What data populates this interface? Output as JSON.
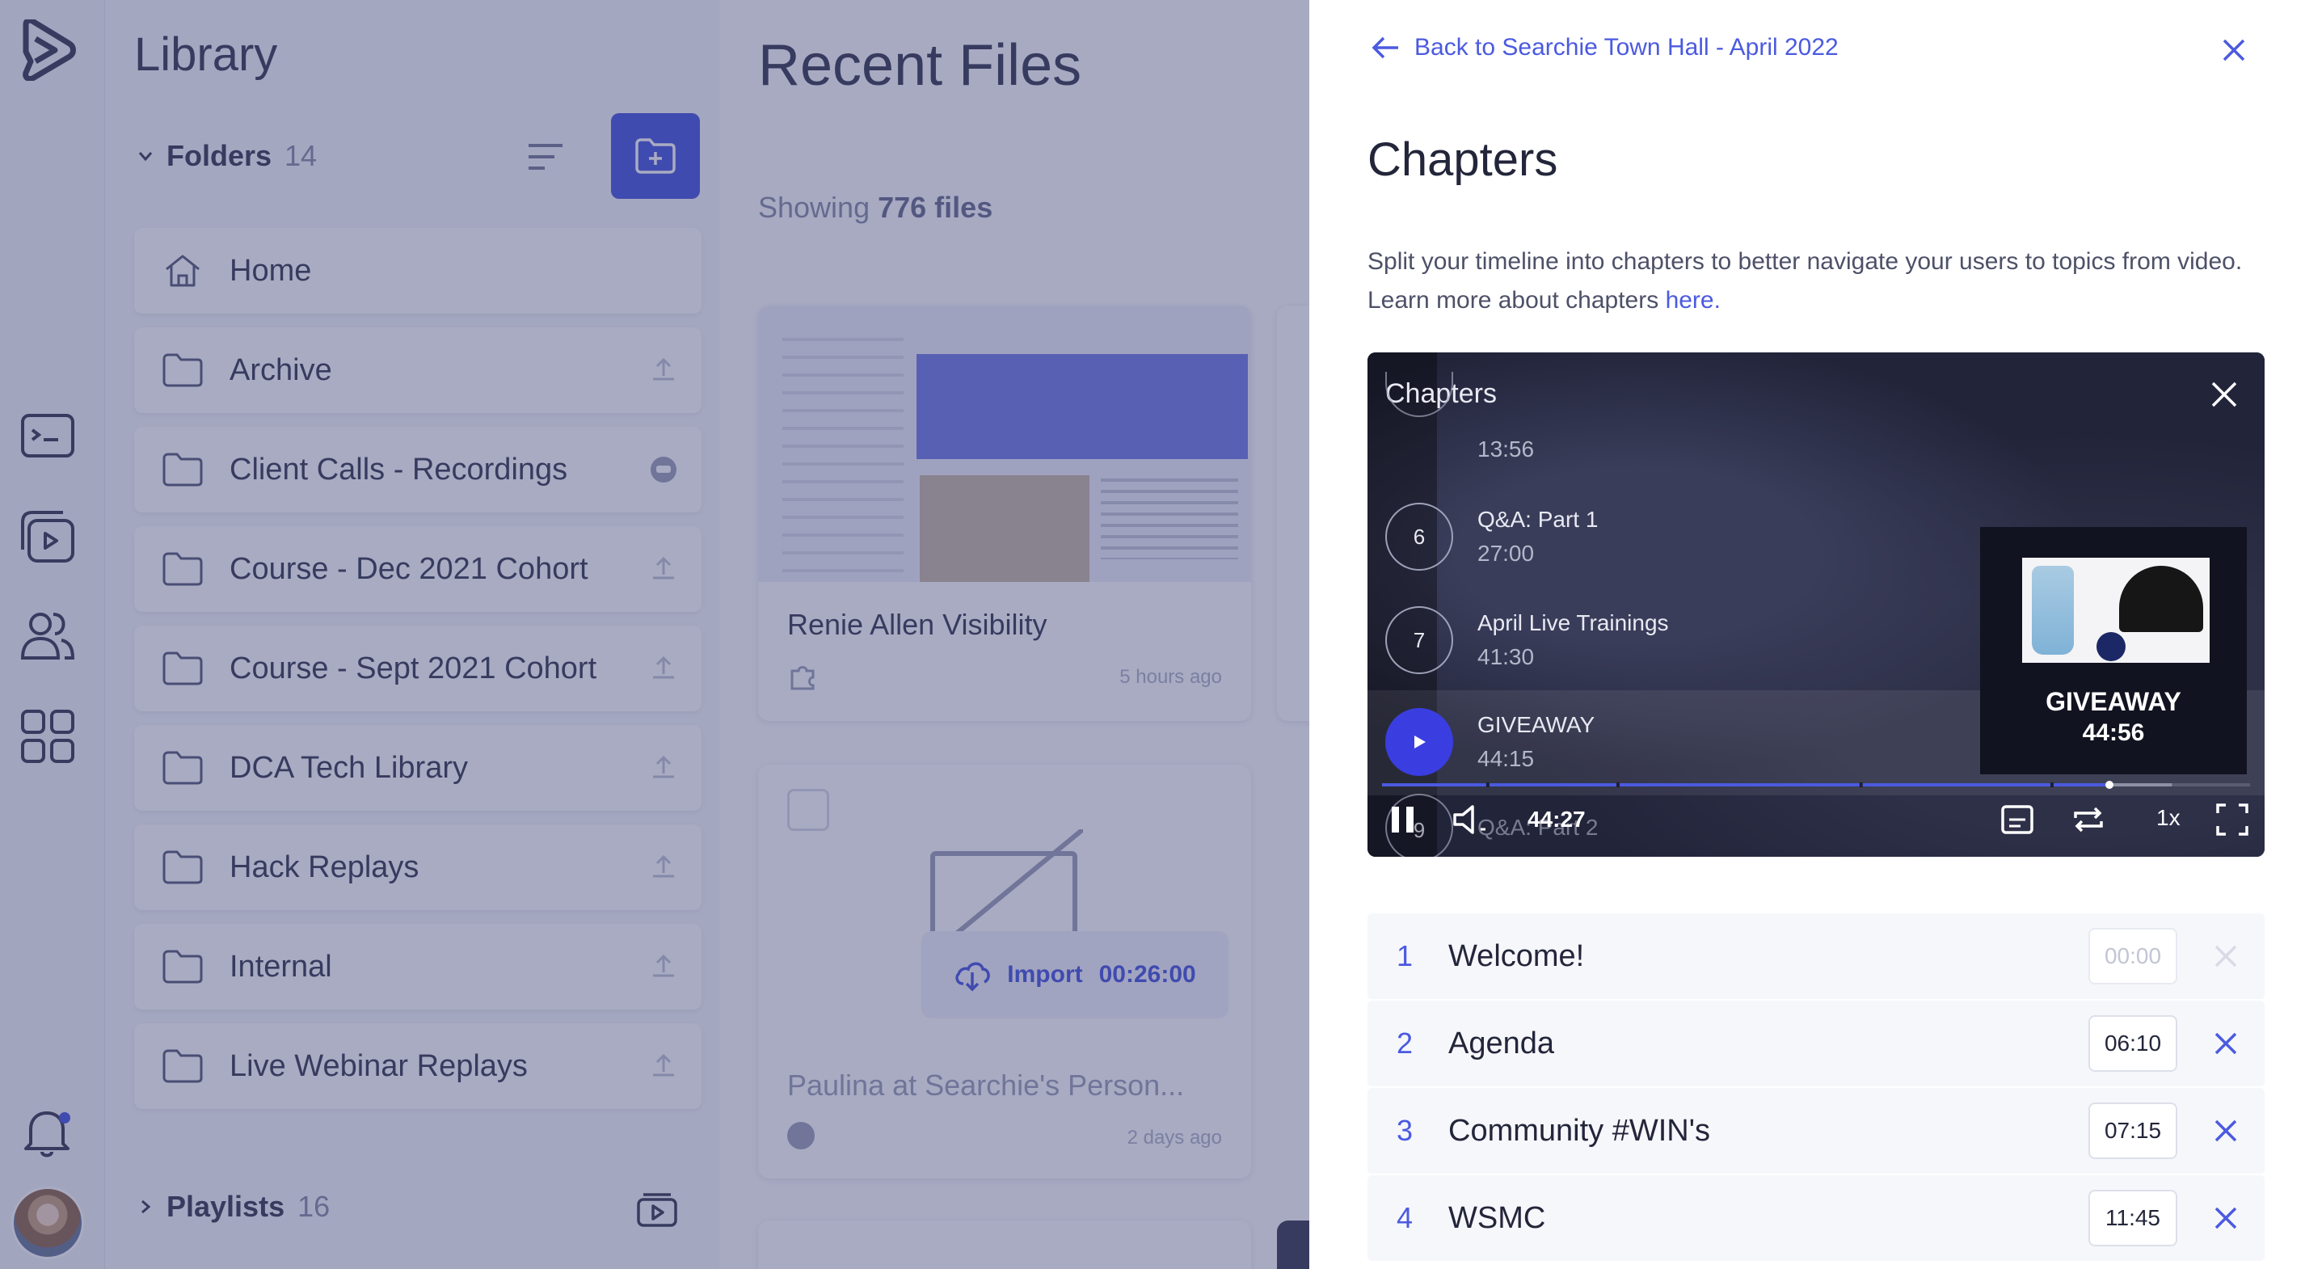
{
  "library": {
    "title": "Library",
    "folders_label": "Folders",
    "folders_count": "14",
    "playlists_label": "Playlists",
    "playlists_count": "16",
    "folders": [
      {
        "label": "Home",
        "icon": "home-icon"
      },
      {
        "label": "Archive",
        "icon": "folder-icon"
      },
      {
        "label": "Client Calls - Recordings",
        "icon": "folder-icon"
      },
      {
        "label": "Course - Dec 2021 Cohort",
        "icon": "folder-icon"
      },
      {
        "label": "Course - Sept 2021 Cohort",
        "icon": "folder-icon"
      },
      {
        "label": "DCA Tech Library",
        "icon": "folder-icon"
      },
      {
        "label": "Hack Replays",
        "icon": "folder-icon"
      },
      {
        "label": "Internal",
        "icon": "folder-icon"
      },
      {
        "label": "Live Webinar Replays",
        "icon": "folder-icon"
      }
    ]
  },
  "recent": {
    "title": "Recent Files",
    "showing_prefix": "Showing",
    "showing_count": "776 files",
    "cards": [
      {
        "title": "Renie Allen Visibility",
        "meta": "5 hours ago"
      },
      {
        "title": "Paulina at Searchie's Person...",
        "meta": "2 days ago",
        "import_label": "Import",
        "import_time": "00:26:00"
      }
    ]
  },
  "panel": {
    "back_label": "Back to Searchie Town Hall - April 2022",
    "title": "Chapters",
    "desc": "Split your timeline into chapters to better navigate your users to topics from video. Learn more about chapters ",
    "desc_link": "here."
  },
  "player": {
    "chapters_label": "Chapters",
    "partial_top_time": "13:56",
    "items": [
      {
        "num": "6",
        "name": "Q&A: Part 1",
        "time": "27:00"
      },
      {
        "num": "7",
        "name": "April Live Trainings",
        "time": "41:30"
      },
      {
        "num": "",
        "name": "GIVEAWAY",
        "time": "44:15"
      }
    ],
    "peek_num": "9",
    "peek_label": "Q&A: Part 2",
    "preview_label": "GIVEAWAY",
    "preview_time": "44:56",
    "current_time": "44:27",
    "speed": "1x",
    "progress_played": 0.838,
    "progress_buffered": 0.91
  },
  "chapters": [
    {
      "index": "1",
      "title": "Welcome!",
      "time": "00:00",
      "locked": true
    },
    {
      "index": "2",
      "title": "Agenda",
      "time": "06:10",
      "locked": false
    },
    {
      "index": "3",
      "title": "Community #WIN's",
      "time": "07:15",
      "locked": false
    },
    {
      "index": "4",
      "title": "WSMC",
      "time": "11:45",
      "locked": false
    }
  ],
  "colors": {
    "accent": "#4b5ae0",
    "player_play": "#3a3ee0",
    "overlay": "#32386e"
  }
}
